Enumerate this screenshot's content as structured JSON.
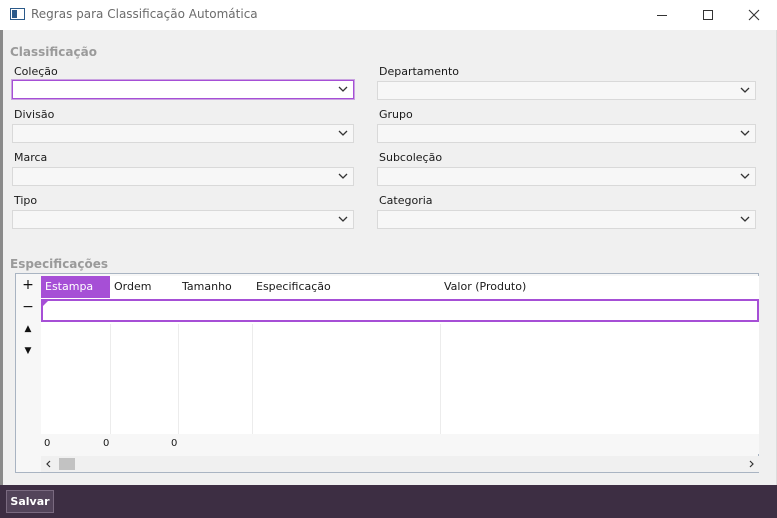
{
  "window": {
    "title": "Regras para Classificação Automática"
  },
  "classification": {
    "section_title": "Classificação",
    "fields": [
      {
        "label": "Coleção",
        "value": ""
      },
      {
        "label": "Departamento",
        "value": ""
      },
      {
        "label": "Divisão",
        "value": ""
      },
      {
        "label": "Grupo",
        "value": ""
      },
      {
        "label": "Marca",
        "value": ""
      },
      {
        "label": "Subcoleção",
        "value": ""
      },
      {
        "label": "Tipo",
        "value": ""
      },
      {
        "label": "Categoria",
        "value": ""
      }
    ]
  },
  "specifications": {
    "section_title": "Especificações",
    "toolbar": {
      "add": "+",
      "remove": "−",
      "up": "▲",
      "down": "▼"
    },
    "columns": [
      "Estampa",
      "Ordem",
      "Tamanho",
      "Especificação",
      "Valor (Produto)"
    ],
    "footer_totals": [
      "0",
      "0",
      "0"
    ]
  },
  "footer": {
    "save_label": "Salvar"
  },
  "colors": {
    "accent": "#a64fd6",
    "bottom_bar": "#3d2e43"
  }
}
